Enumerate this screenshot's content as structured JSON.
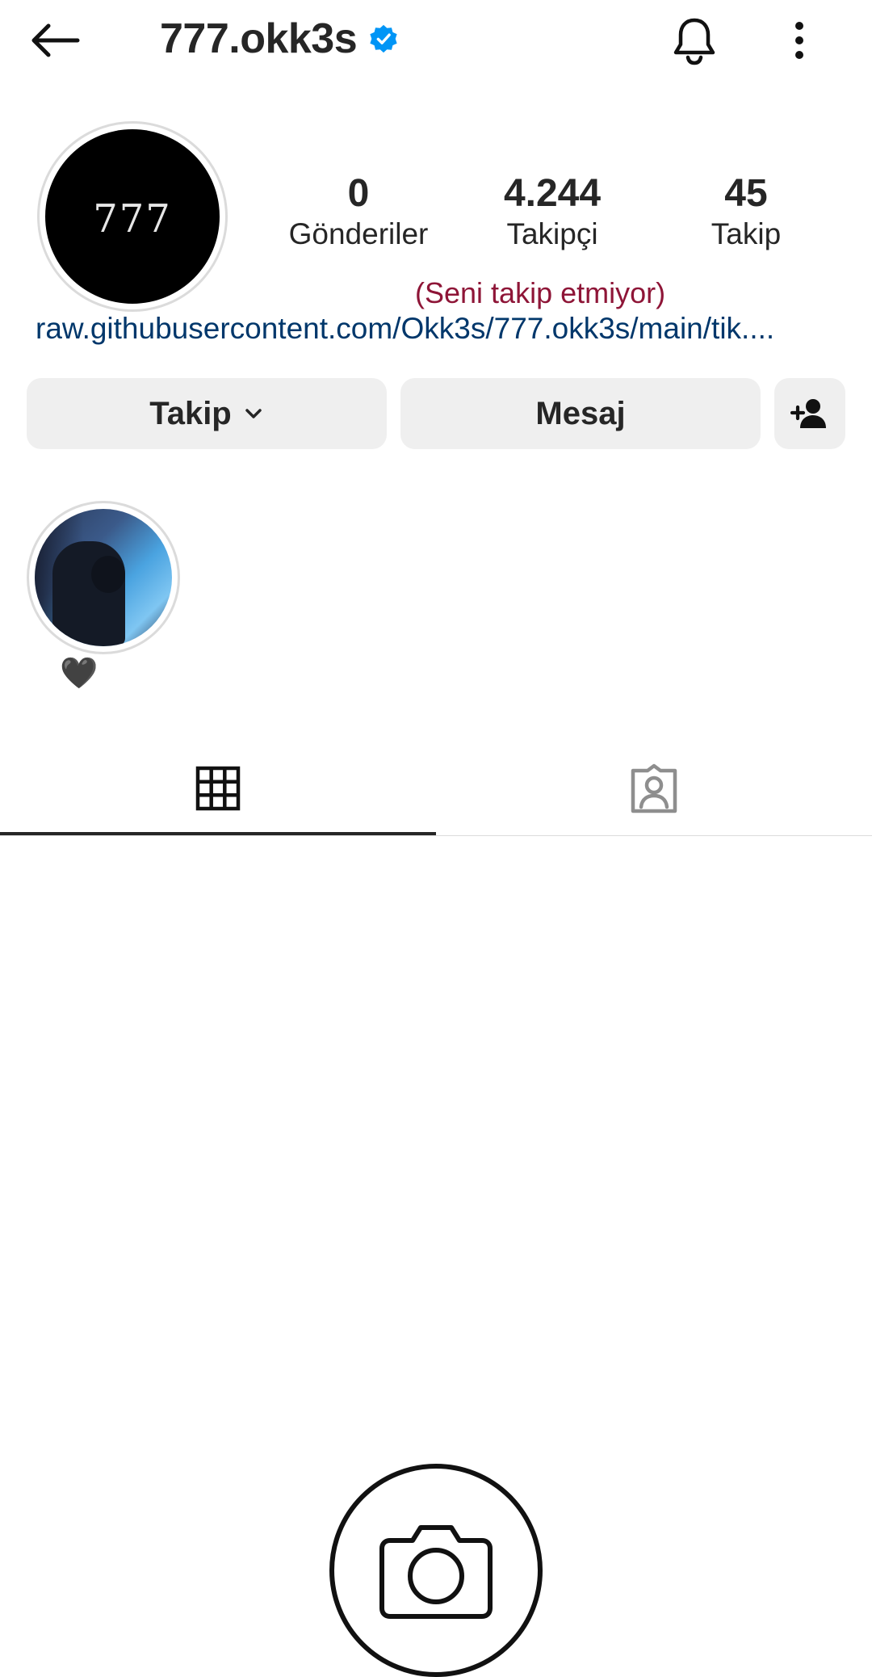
{
  "header": {
    "username": "777.okk3s",
    "back_icon": "arrow-left-icon",
    "verified_icon": "verified-badge-icon",
    "bell_icon": "bell-icon",
    "more_icon": "more-vertical-icon"
  },
  "profile": {
    "avatar_text": "777",
    "stats": [
      {
        "value": "0",
        "label": "Gönderiler"
      },
      {
        "value": "4.244",
        "label": "Takipçi"
      },
      {
        "value": "45",
        "label": "Takip"
      }
    ],
    "not_following_text": "(Seni takip etmiyor)",
    "bio_link": "raw.githubusercontent.com/Okk3s/777.okk3s/main/tik...."
  },
  "actions": {
    "follow_label": "Takip",
    "message_label": "Mesaj",
    "add_user_icon": "person-add-icon"
  },
  "highlights": [
    {
      "label": "🖤"
    }
  ],
  "tabs": {
    "grid_icon": "grid-icon",
    "tagged_icon": "tagged-person-icon",
    "active": "grid"
  },
  "empty_state": {
    "icon": "camera-icon"
  },
  "colors": {
    "verified": "#0095f6",
    "not_following": "#8e1537",
    "link": "#00376b",
    "button_bg": "#efefef"
  }
}
